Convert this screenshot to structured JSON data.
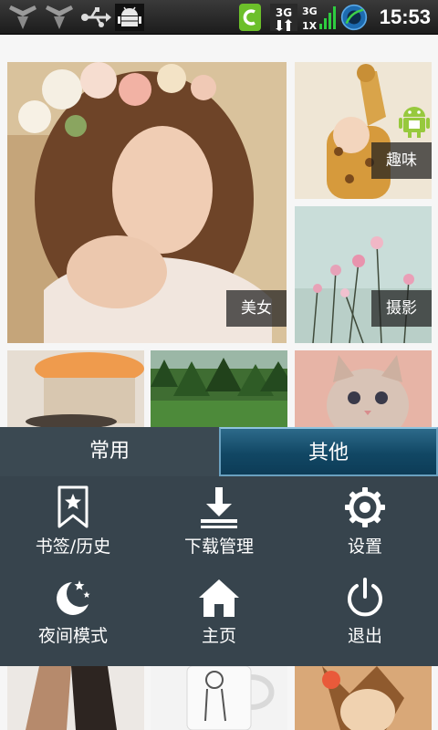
{
  "status_bar": {
    "time": "15:53",
    "icons": [
      "signal-weak-icon",
      "signal-weak-icon",
      "usb-icon",
      "android-debug-icon",
      "c-app-icon",
      "3g-data-icon",
      "3g-signal-bars-icon",
      "browser-globe-icon"
    ],
    "network_label": "3G",
    "roaming_label": "1X"
  },
  "gallery": {
    "tiles": [
      {
        "label": "美女"
      },
      {
        "label": "趣味"
      },
      {
        "label": "摄影"
      }
    ]
  },
  "menu": {
    "tabs": [
      {
        "label": "常用",
        "selected": true
      },
      {
        "label": "其他",
        "selected": false
      }
    ],
    "items": [
      {
        "label": "书签/历史",
        "icon": "bookmark-star-icon"
      },
      {
        "label": "下载管理",
        "icon": "download-icon"
      },
      {
        "label": "设置",
        "icon": "gear-icon"
      },
      {
        "label": "夜间模式",
        "icon": "night-moon-icon"
      },
      {
        "label": "主页",
        "icon": "home-icon"
      },
      {
        "label": "退出",
        "icon": "power-icon"
      }
    ]
  },
  "colors": {
    "menu_bg": "#38444d",
    "selected_tab": "#114764"
  }
}
